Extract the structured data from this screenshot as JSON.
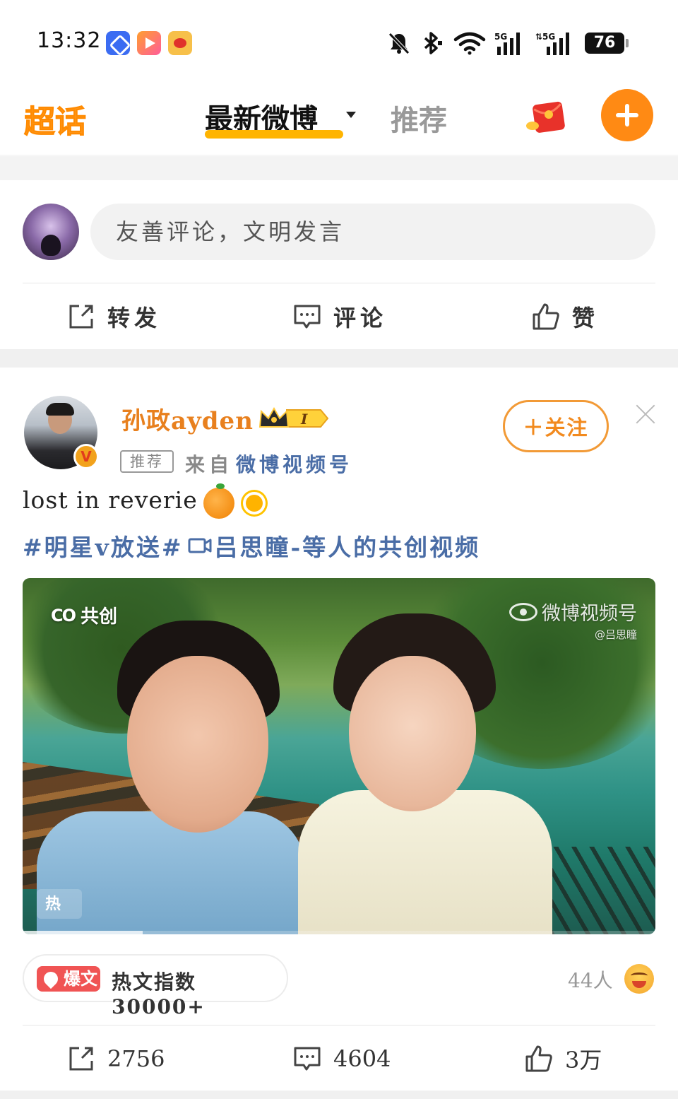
{
  "status_bar": {
    "time": "13:32",
    "app_icons": [
      "app-blue-icon",
      "video-app-icon",
      "weibo-app-icon"
    ],
    "icons": [
      "bell-muted-icon",
      "bluetooth-icon",
      "wifi-icon",
      "signal-5g-icon",
      "signal-5g-icon"
    ],
    "net1": "5G",
    "net2": "5G",
    "battery": "76"
  },
  "top_nav": {
    "logo": "超话",
    "tabs": [
      {
        "label": "最新微博",
        "active": true
      },
      {
        "label": "推荐",
        "active": false
      }
    ],
    "accent": "#ffb400",
    "plus_color": "#ff8a14"
  },
  "comment_box": {
    "placeholder": "友善评论，文明发言",
    "actions": [
      {
        "icon": "share-icon",
        "label": "转发"
      },
      {
        "icon": "comment-icon",
        "label": "评论"
      },
      {
        "icon": "like-icon",
        "label": "赞"
      }
    ]
  },
  "post": {
    "author": "孙政ayden",
    "level_badge": "I",
    "recommend_tag": "推荐",
    "from_label": "来自",
    "source": "微博视频号",
    "follow_label": "关注",
    "text": "lost in reverie",
    "text_emojis": [
      "orange-emoji",
      "sun-emoji"
    ],
    "topic": "#明星v放送#",
    "video_link": "吕思瞳-等人的共创视频",
    "video": {
      "co_label": "共创",
      "co_icon": "CO",
      "watermark": "微博视频号",
      "watermark_sub": "@吕思瞳",
      "hot_label": "热",
      "progress": 0.19
    },
    "hot": {
      "badge": "爆文",
      "text": "热文指数30000+"
    },
    "reactions": {
      "count": "44人",
      "emoji": "laugh-emoji"
    },
    "stats": {
      "reposts": "2756",
      "comments": "4604",
      "likes": "3万"
    }
  }
}
